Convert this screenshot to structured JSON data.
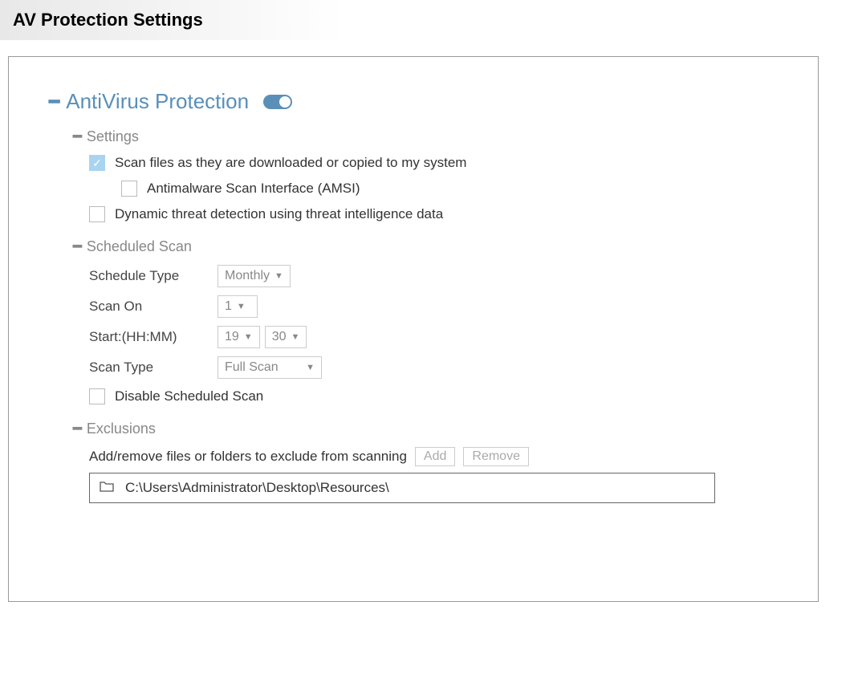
{
  "page_title": "AV Protection Settings",
  "main": {
    "title": "AntiVirus Protection",
    "toggle_on": true
  },
  "settings": {
    "title": "Settings",
    "scan_downloaded": {
      "label": "Scan files as they are downloaded or copied to my system",
      "checked": true
    },
    "amsi": {
      "label": "Antimalware Scan Interface (AMSI)",
      "checked": false
    },
    "dynamic_threat": {
      "label": "Dynamic threat detection using threat intelligence data",
      "checked": false
    }
  },
  "scheduled": {
    "title": "Scheduled Scan",
    "schedule_type_label": "Schedule Type",
    "schedule_type_value": "Monthly",
    "scan_on_label": "Scan On",
    "scan_on_value": "1",
    "start_label": "Start:(HH:MM)",
    "start_hh": "19",
    "start_mm": "30",
    "scan_type_label": "Scan Type",
    "scan_type_value": "Full Scan",
    "disable_label": "Disable Scheduled Scan",
    "disable_checked": false
  },
  "exclusions": {
    "title": "Exclusions",
    "desc": "Add/remove files or folders to exclude from scanning",
    "add_label": "Add",
    "remove_label": "Remove",
    "items": [
      "C:\\Users\\Administrator\\Desktop\\Resources\\"
    ]
  }
}
